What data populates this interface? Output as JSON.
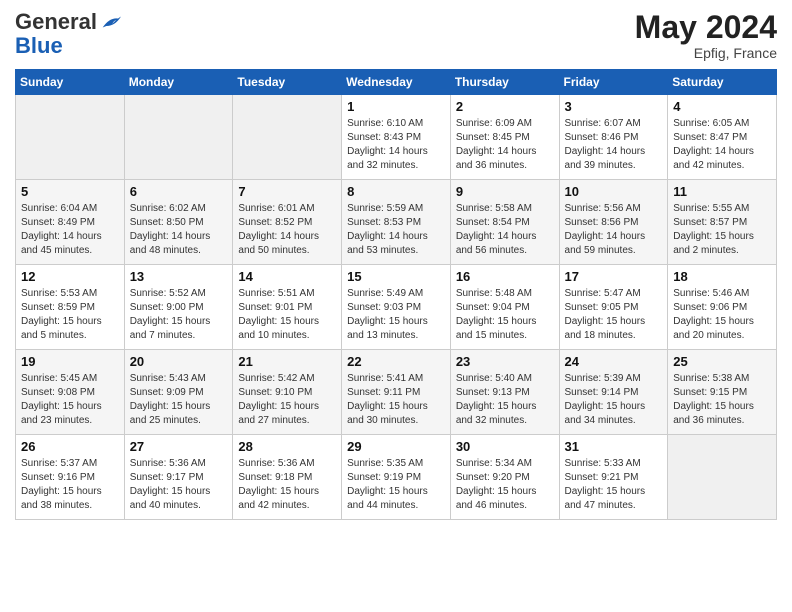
{
  "header": {
    "logo_general": "General",
    "logo_blue": "Blue",
    "month_year": "May 2024",
    "location": "Epfig, France"
  },
  "weekdays": [
    "Sunday",
    "Monday",
    "Tuesday",
    "Wednesday",
    "Thursday",
    "Friday",
    "Saturday"
  ],
  "weeks": [
    [
      {
        "day": "",
        "sunrise": "",
        "sunset": "",
        "daylight": ""
      },
      {
        "day": "",
        "sunrise": "",
        "sunset": "",
        "daylight": ""
      },
      {
        "day": "",
        "sunrise": "",
        "sunset": "",
        "daylight": ""
      },
      {
        "day": "1",
        "sunrise": "Sunrise: 6:10 AM",
        "sunset": "Sunset: 8:43 PM",
        "daylight": "Daylight: 14 hours and 32 minutes."
      },
      {
        "day": "2",
        "sunrise": "Sunrise: 6:09 AM",
        "sunset": "Sunset: 8:45 PM",
        "daylight": "Daylight: 14 hours and 36 minutes."
      },
      {
        "day": "3",
        "sunrise": "Sunrise: 6:07 AM",
        "sunset": "Sunset: 8:46 PM",
        "daylight": "Daylight: 14 hours and 39 minutes."
      },
      {
        "day": "4",
        "sunrise": "Sunrise: 6:05 AM",
        "sunset": "Sunset: 8:47 PM",
        "daylight": "Daylight: 14 hours and 42 minutes."
      }
    ],
    [
      {
        "day": "5",
        "sunrise": "Sunrise: 6:04 AM",
        "sunset": "Sunset: 8:49 PM",
        "daylight": "Daylight: 14 hours and 45 minutes."
      },
      {
        "day": "6",
        "sunrise": "Sunrise: 6:02 AM",
        "sunset": "Sunset: 8:50 PM",
        "daylight": "Daylight: 14 hours and 48 minutes."
      },
      {
        "day": "7",
        "sunrise": "Sunrise: 6:01 AM",
        "sunset": "Sunset: 8:52 PM",
        "daylight": "Daylight: 14 hours and 50 minutes."
      },
      {
        "day": "8",
        "sunrise": "Sunrise: 5:59 AM",
        "sunset": "Sunset: 8:53 PM",
        "daylight": "Daylight: 14 hours and 53 minutes."
      },
      {
        "day": "9",
        "sunrise": "Sunrise: 5:58 AM",
        "sunset": "Sunset: 8:54 PM",
        "daylight": "Daylight: 14 hours and 56 minutes."
      },
      {
        "day": "10",
        "sunrise": "Sunrise: 5:56 AM",
        "sunset": "Sunset: 8:56 PM",
        "daylight": "Daylight: 14 hours and 59 minutes."
      },
      {
        "day": "11",
        "sunrise": "Sunrise: 5:55 AM",
        "sunset": "Sunset: 8:57 PM",
        "daylight": "Daylight: 15 hours and 2 minutes."
      }
    ],
    [
      {
        "day": "12",
        "sunrise": "Sunrise: 5:53 AM",
        "sunset": "Sunset: 8:59 PM",
        "daylight": "Daylight: 15 hours and 5 minutes."
      },
      {
        "day": "13",
        "sunrise": "Sunrise: 5:52 AM",
        "sunset": "Sunset: 9:00 PM",
        "daylight": "Daylight: 15 hours and 7 minutes."
      },
      {
        "day": "14",
        "sunrise": "Sunrise: 5:51 AM",
        "sunset": "Sunset: 9:01 PM",
        "daylight": "Daylight: 15 hours and 10 minutes."
      },
      {
        "day": "15",
        "sunrise": "Sunrise: 5:49 AM",
        "sunset": "Sunset: 9:03 PM",
        "daylight": "Daylight: 15 hours and 13 minutes."
      },
      {
        "day": "16",
        "sunrise": "Sunrise: 5:48 AM",
        "sunset": "Sunset: 9:04 PM",
        "daylight": "Daylight: 15 hours and 15 minutes."
      },
      {
        "day": "17",
        "sunrise": "Sunrise: 5:47 AM",
        "sunset": "Sunset: 9:05 PM",
        "daylight": "Daylight: 15 hours and 18 minutes."
      },
      {
        "day": "18",
        "sunrise": "Sunrise: 5:46 AM",
        "sunset": "Sunset: 9:06 PM",
        "daylight": "Daylight: 15 hours and 20 minutes."
      }
    ],
    [
      {
        "day": "19",
        "sunrise": "Sunrise: 5:45 AM",
        "sunset": "Sunset: 9:08 PM",
        "daylight": "Daylight: 15 hours and 23 minutes."
      },
      {
        "day": "20",
        "sunrise": "Sunrise: 5:43 AM",
        "sunset": "Sunset: 9:09 PM",
        "daylight": "Daylight: 15 hours and 25 minutes."
      },
      {
        "day": "21",
        "sunrise": "Sunrise: 5:42 AM",
        "sunset": "Sunset: 9:10 PM",
        "daylight": "Daylight: 15 hours and 27 minutes."
      },
      {
        "day": "22",
        "sunrise": "Sunrise: 5:41 AM",
        "sunset": "Sunset: 9:11 PM",
        "daylight": "Daylight: 15 hours and 30 minutes."
      },
      {
        "day": "23",
        "sunrise": "Sunrise: 5:40 AM",
        "sunset": "Sunset: 9:13 PM",
        "daylight": "Daylight: 15 hours and 32 minutes."
      },
      {
        "day": "24",
        "sunrise": "Sunrise: 5:39 AM",
        "sunset": "Sunset: 9:14 PM",
        "daylight": "Daylight: 15 hours and 34 minutes."
      },
      {
        "day": "25",
        "sunrise": "Sunrise: 5:38 AM",
        "sunset": "Sunset: 9:15 PM",
        "daylight": "Daylight: 15 hours and 36 minutes."
      }
    ],
    [
      {
        "day": "26",
        "sunrise": "Sunrise: 5:37 AM",
        "sunset": "Sunset: 9:16 PM",
        "daylight": "Daylight: 15 hours and 38 minutes."
      },
      {
        "day": "27",
        "sunrise": "Sunrise: 5:36 AM",
        "sunset": "Sunset: 9:17 PM",
        "daylight": "Daylight: 15 hours and 40 minutes."
      },
      {
        "day": "28",
        "sunrise": "Sunrise: 5:36 AM",
        "sunset": "Sunset: 9:18 PM",
        "daylight": "Daylight: 15 hours and 42 minutes."
      },
      {
        "day": "29",
        "sunrise": "Sunrise: 5:35 AM",
        "sunset": "Sunset: 9:19 PM",
        "daylight": "Daylight: 15 hours and 44 minutes."
      },
      {
        "day": "30",
        "sunrise": "Sunrise: 5:34 AM",
        "sunset": "Sunset: 9:20 PM",
        "daylight": "Daylight: 15 hours and 46 minutes."
      },
      {
        "day": "31",
        "sunrise": "Sunrise: 5:33 AM",
        "sunset": "Sunset: 9:21 PM",
        "daylight": "Daylight: 15 hours and 47 minutes."
      },
      {
        "day": "",
        "sunrise": "",
        "sunset": "",
        "daylight": ""
      }
    ]
  ]
}
